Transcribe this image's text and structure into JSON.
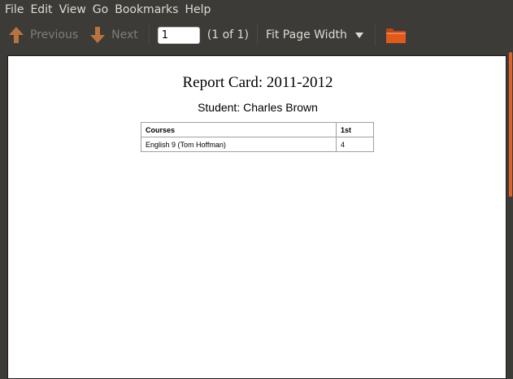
{
  "menubar": {
    "items": [
      "File",
      "Edit",
      "View",
      "Go",
      "Bookmarks",
      "Help"
    ]
  },
  "toolbar": {
    "previous_label": "Previous",
    "next_label": "Next",
    "page_value": "1",
    "page_count": "(1 of 1)",
    "zoom_label": "Fit Page Width"
  },
  "colors": {
    "accent": "#e0622b",
    "arrow": "#b8743f",
    "folder": "#e05a1c"
  },
  "document": {
    "title": "Report Card: 2011-2012",
    "student": "Student: Charles Brown",
    "table": {
      "headers": [
        "Courses",
        "1st"
      ],
      "rows": [
        [
          "English 9 (Tom Hoffman)",
          "4"
        ]
      ]
    }
  }
}
